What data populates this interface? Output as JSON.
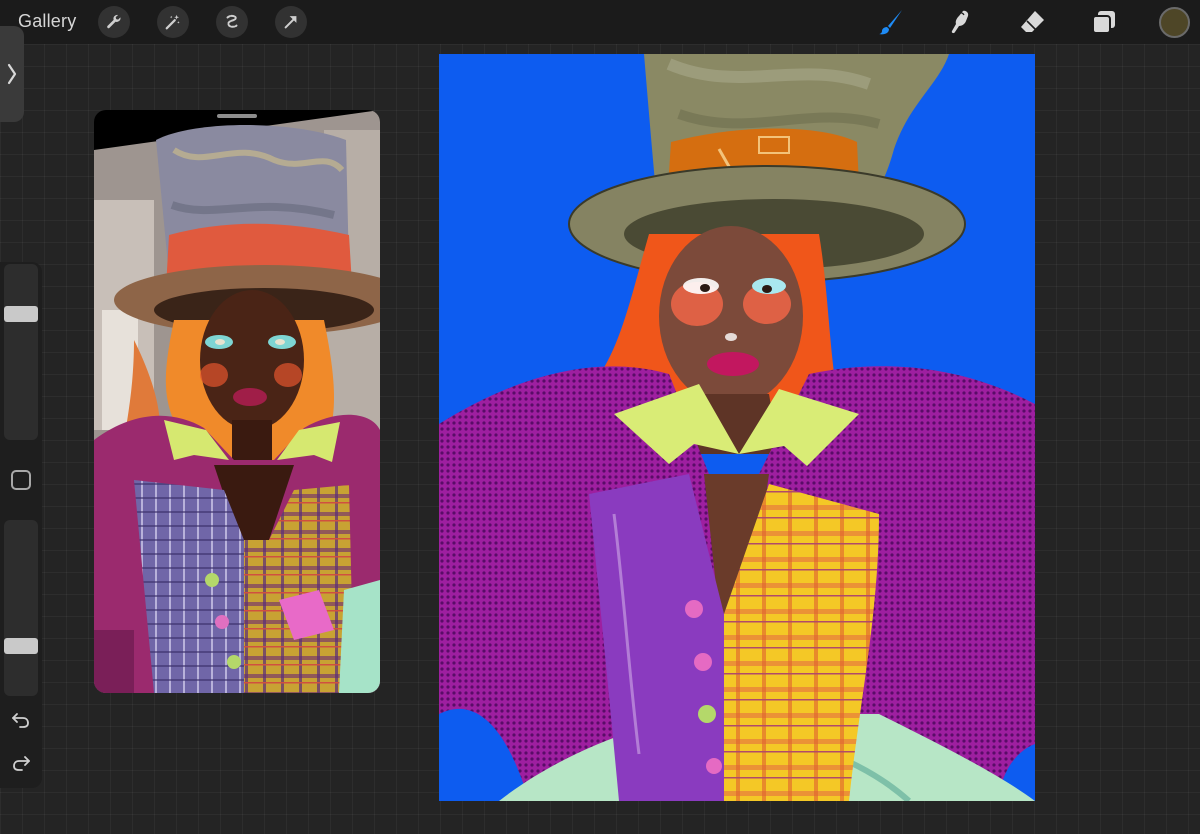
{
  "toolbar": {
    "gallery_label": "Gallery",
    "left_tools": [
      "wrench-icon",
      "magic-wand-icon",
      "selection-icon",
      "transform-arrow-icon"
    ],
    "right_tools": [
      "brush-icon",
      "smudge-icon",
      "eraser-icon",
      "layers-icon"
    ],
    "active_tool": "brush-icon",
    "accent_color": "#1e8bf5",
    "current_color": "#4e4627"
  },
  "sidebar": {
    "expand_icon": "chevron-right-icon",
    "brush_size": 0.75,
    "opacity": 0.25,
    "modify_icon": "square-icon",
    "undo_icon": "undo-icon",
    "redo_icon": "redo-icon"
  },
  "reference": {
    "subject": "photo-reference"
  },
  "canvas": {
    "background_color": "#0d5cf0",
    "subject": "illustration"
  }
}
